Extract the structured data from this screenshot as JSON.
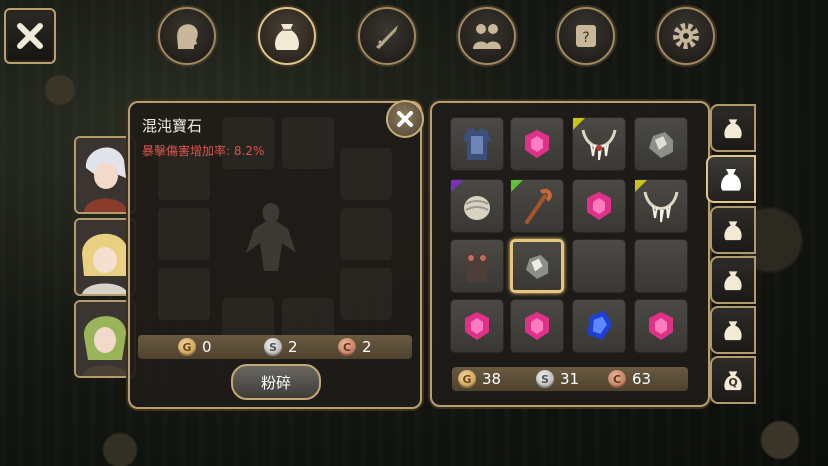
{
  "top_tabs": [
    {
      "name": "character",
      "icon": "head-icon"
    },
    {
      "name": "bag",
      "icon": "bag-icon",
      "active": true
    },
    {
      "name": "skills",
      "icon": "sword-icon"
    },
    {
      "name": "party",
      "icon": "people-icon"
    },
    {
      "name": "quest",
      "icon": "scroll-icon"
    },
    {
      "name": "settings",
      "icon": "gear-icon"
    }
  ],
  "item_detail": {
    "title": "混沌寶石",
    "stat": "暴擊傷害增加率: 8.2%",
    "stat_color": "#d9534f"
  },
  "left_currency": {
    "gold": "0",
    "silver": "2",
    "copper": "2"
  },
  "smash_label": "粉碎",
  "right_currency": {
    "gold": "38",
    "silver": "31",
    "copper": "63"
  },
  "coin_letters": {
    "gold": "G",
    "silver": "S",
    "copper": "C"
  },
  "side_tabs": [
    "bag-1",
    "bag-2",
    "bag-3",
    "bag-4",
    "bag-5",
    "bag-quest"
  ],
  "side_tab_quest_letter": "Q",
  "inventory": [
    [
      "armor",
      "pink-gem",
      "necklace",
      "ore"
    ],
    [
      "bandage",
      "staff",
      "pink-gem",
      "necklace"
    ],
    [
      "armor-dark",
      "ore",
      "empty",
      "empty"
    ],
    [
      "pink-gem",
      "pink-gem",
      "blue-gem",
      "pink-gem"
    ]
  ],
  "colors": {
    "accent": "#e8c680",
    "rare_yellow": "#c9c21a",
    "rare_purple": "#7b2fc2",
    "rare_green": "#5fc22f"
  }
}
